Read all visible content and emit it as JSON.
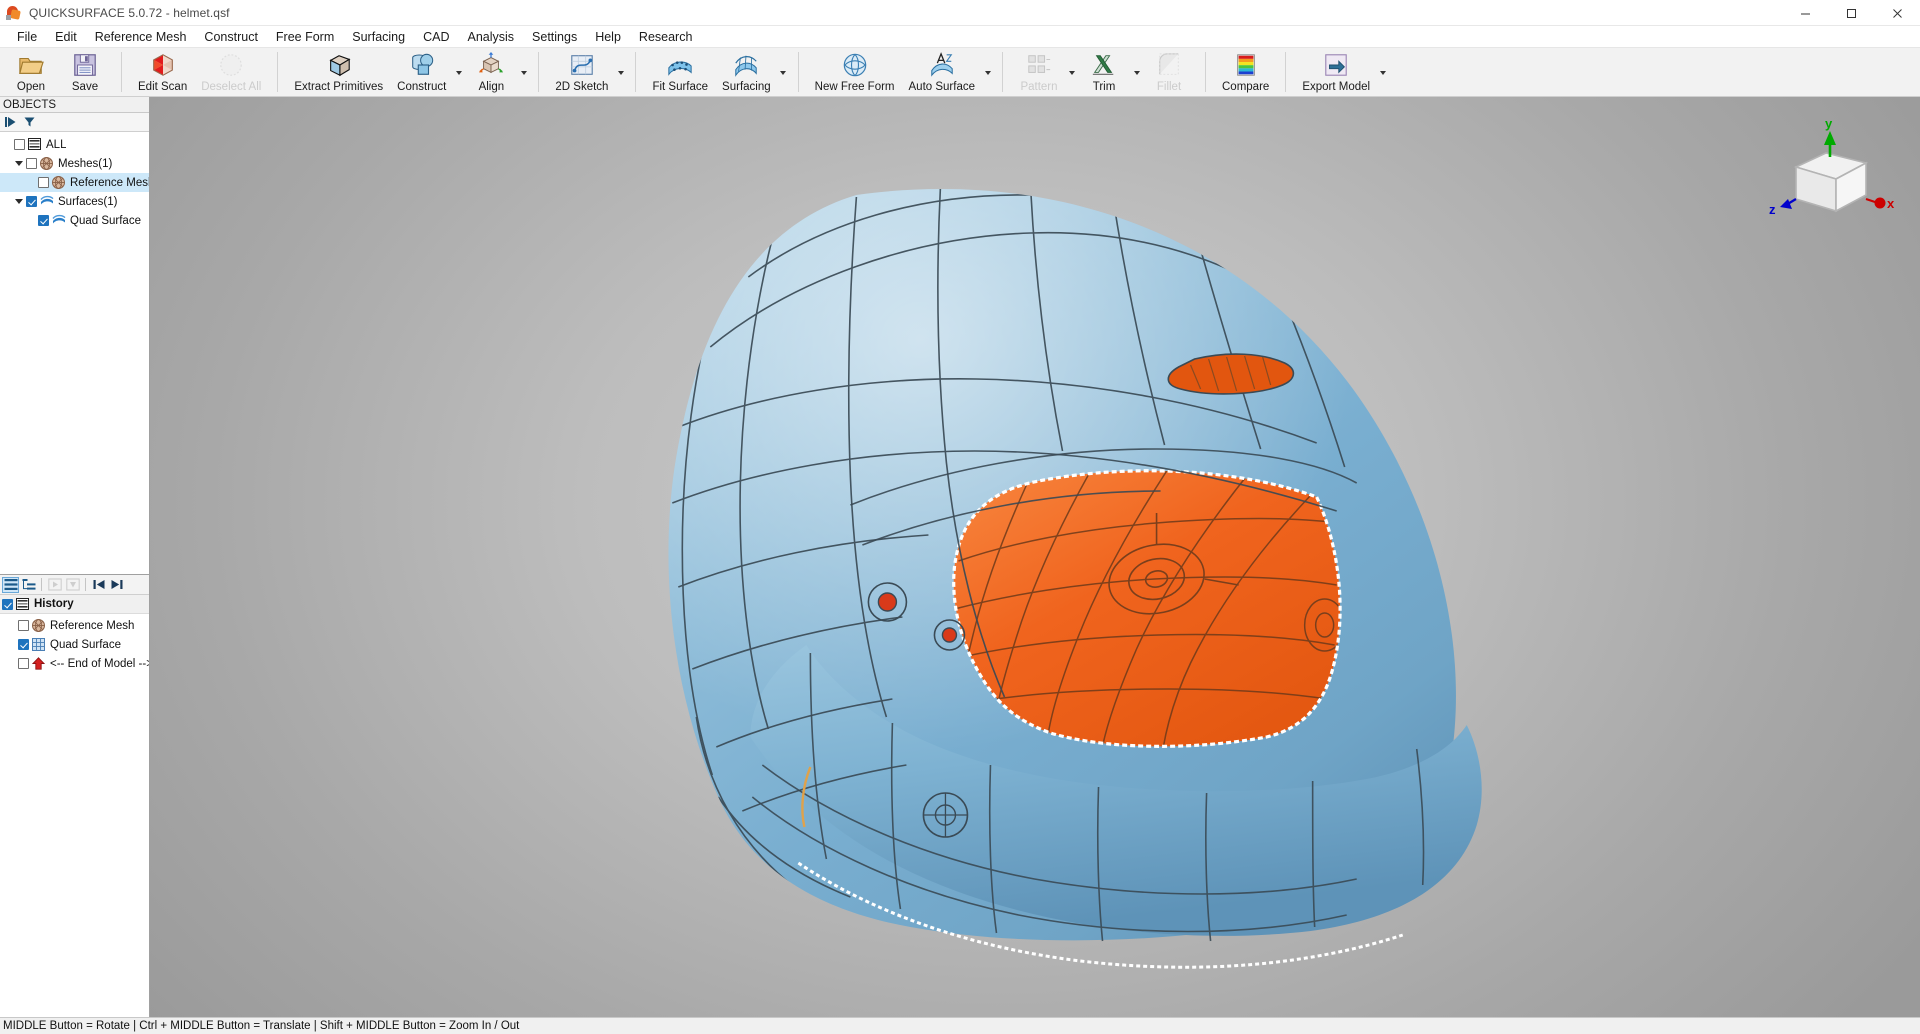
{
  "window": {
    "title": "QUICKSURFACE 5.0.72 - helmet.qsf",
    "app_icon": "quicksurface-logo-icon",
    "minimize_label": "–",
    "maximize_label": "❐",
    "close_label": "✕"
  },
  "menubar": {
    "items": [
      {
        "label": "File"
      },
      {
        "label": "Edit"
      },
      {
        "label": "Reference Mesh"
      },
      {
        "label": "Construct"
      },
      {
        "label": "Free Form"
      },
      {
        "label": "Surfacing"
      },
      {
        "label": "CAD"
      },
      {
        "label": "Analysis"
      },
      {
        "label": "Settings"
      },
      {
        "label": "Help"
      },
      {
        "label": "Research"
      }
    ]
  },
  "ribbon": {
    "groups": [
      {
        "buttons": [
          {
            "label": "Open",
            "icon": "folder-open-icon",
            "disabled": false,
            "dropdown": false
          },
          {
            "label": "Save",
            "icon": "floppy-disk-icon",
            "disabled": false,
            "dropdown": false
          }
        ]
      },
      {
        "buttons": [
          {
            "label": "Edit Scan",
            "icon": "mesh-hexagon-icon",
            "disabled": false,
            "dropdown": false
          },
          {
            "label": "Deselect All",
            "icon": "circle-gray-icon",
            "disabled": true,
            "dropdown": false
          }
        ]
      },
      {
        "buttons": [
          {
            "label": "Extract Primitives",
            "icon": "cube-icon",
            "disabled": false,
            "dropdown": false
          },
          {
            "label": "Construct",
            "icon": "cylinder-cube-icon",
            "disabled": false,
            "dropdown": true
          },
          {
            "label": "Align",
            "icon": "align-axes-icon",
            "disabled": false,
            "dropdown": true
          }
        ]
      },
      {
        "buttons": [
          {
            "label": "2D Sketch",
            "icon": "sketch-icon",
            "disabled": false,
            "dropdown": true
          }
        ]
      },
      {
        "buttons": [
          {
            "label": "Fit Surface",
            "icon": "fit-surface-icon",
            "disabled": false,
            "dropdown": false
          },
          {
            "label": "Surfacing",
            "icon": "surfacing-icon",
            "disabled": false,
            "dropdown": true
          }
        ]
      },
      {
        "buttons": [
          {
            "label": "New Free Form",
            "icon": "free-form-icon",
            "disabled": false,
            "dropdown": false
          },
          {
            "label": "Auto Surface",
            "icon": "auto-surface-icon",
            "disabled": false,
            "dropdown": true
          }
        ]
      },
      {
        "buttons": [
          {
            "label": "Pattern",
            "icon": "pattern-icon",
            "disabled": true,
            "dropdown": true
          },
          {
            "label": "Trim",
            "icon": "trim-icon",
            "disabled": false,
            "dropdown": true
          },
          {
            "label": "Fillet",
            "icon": "fillet-icon",
            "disabled": true,
            "dropdown": false
          }
        ]
      },
      {
        "buttons": [
          {
            "label": "Compare",
            "icon": "rainbow-deviation-icon",
            "disabled": false,
            "dropdown": false
          }
        ]
      },
      {
        "buttons": [
          {
            "label": "Export Model",
            "icon": "export-arrow-icon",
            "disabled": false,
            "dropdown": true
          }
        ]
      }
    ]
  },
  "objects_panel": {
    "header": "OBJECTS",
    "toolbar": [
      {
        "icon": "play-filter-icon"
      },
      {
        "icon": "funnel-filter-icon"
      }
    ],
    "tree": [
      {
        "label": "ALL",
        "indent": 0,
        "checked": false,
        "expander": "none",
        "icon": "list-lines-icon",
        "selected": false
      },
      {
        "label": "Meshes(1)",
        "indent": 1,
        "checked": false,
        "expander": "expanded",
        "icon": "mesh-ball-icon",
        "selected": false
      },
      {
        "label": "Reference Mesh (T:",
        "indent": 2,
        "checked": false,
        "expander": "none",
        "icon": "mesh-ball-icon",
        "selected": true
      },
      {
        "label": "Surfaces(1)",
        "indent": 1,
        "checked": true,
        "expander": "expanded",
        "icon": "surface-blue-icon",
        "selected": false
      },
      {
        "label": "Quad Surface",
        "indent": 2,
        "checked": true,
        "expander": "none",
        "icon": "surface-blue-icon",
        "selected": false
      }
    ]
  },
  "history_panel": {
    "header": "History",
    "header_checked": true,
    "header_icon": "list-lines-icon",
    "toolbar": [
      {
        "icon": "flat-list-icon",
        "selected": true,
        "disabled": false
      },
      {
        "icon": "tree-list-icon",
        "selected": false,
        "disabled": false
      },
      {
        "icon": "play-step-icon",
        "selected": false,
        "disabled": true
      },
      {
        "icon": "rollback-icon",
        "selected": false,
        "disabled": true
      },
      {
        "icon": "skip-first-icon",
        "selected": false,
        "disabled": false
      },
      {
        "icon": "skip-last-icon",
        "selected": false,
        "disabled": false
      }
    ],
    "items": [
      {
        "label": "Reference Mesh",
        "checked": false,
        "icon": "mesh-ball-icon"
      },
      {
        "label": "Quad Surface",
        "checked": true,
        "icon": "quad-grid-icon"
      },
      {
        "label": "<-- End of Model -->",
        "checked": false,
        "icon": "red-arrow-up-icon"
      }
    ]
  },
  "viewport": {
    "model_name": "helmet-3d-model",
    "surface_color": "#7fb2d4",
    "highlight_color": "#f0641e",
    "wireframe_color": "#3a4a55",
    "background_top": "#c9c9c9",
    "background_bottom": "#9a9a9a",
    "axis_gizmo": {
      "x_label": "x",
      "y_label": "y",
      "z_label": "z",
      "x_color": "#cc0000",
      "y_color": "#00aa00",
      "z_color": "#0000cc"
    }
  },
  "statusbar": {
    "text": "MIDDLE Button = Rotate | Ctrl + MIDDLE Button = Translate | Shift + MIDDLE Button = Zoom In / Out"
  }
}
